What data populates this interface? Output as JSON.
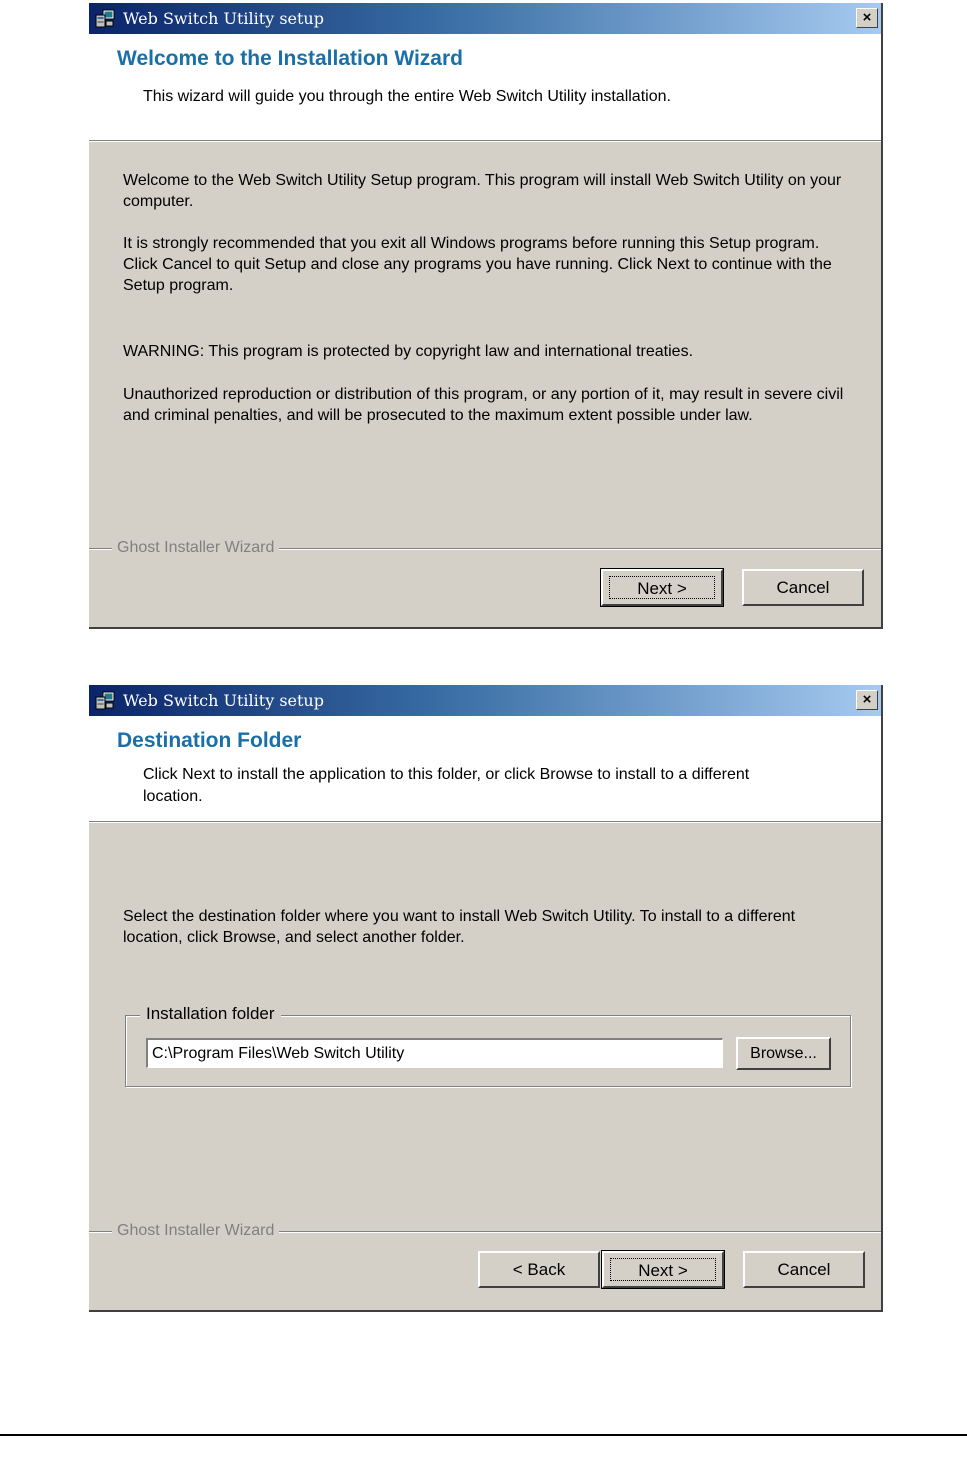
{
  "dialog1": {
    "window_title": "Web Switch Utility setup",
    "close_label": "×",
    "header_title": "Welcome to the Installation Wizard",
    "header_subtitle": "This wizard will guide you through the entire Web Switch Utility installation.",
    "paragraphs": [
      "Welcome to the Web Switch Utility Setup program. This program will install Web Switch Utility on your computer.",
      "It is strongly recommended that you exit all Windows programs before running this Setup program. Click Cancel to quit Setup and close any programs you have running. Click Next to continue with the Setup program.",
      "WARNING: This program is protected by copyright law and international treaties.",
      "Unauthorized reproduction or distribution of this program, or any portion of it, may result in severe civil and criminal penalties, and will be prosecuted to the maximum extent possible under law."
    ],
    "group_label": "Ghost Installer Wizard",
    "buttons": {
      "next": "Next >",
      "cancel": "Cancel"
    }
  },
  "dialog2": {
    "window_title": "Web Switch Utility setup",
    "close_label": "×",
    "header_title": "Destination Folder",
    "header_subtitle": "Click Next to install the application to this folder, or click Browse to install to a different location.",
    "instruction": "Select the destination folder where you want to install Web Switch Utility. To install to a different location, click Browse, and select another folder.",
    "folder_group_label": "Installation folder",
    "folder_path": "C:\\Program Files\\Web Switch Utility",
    "browse_label": "Browse...",
    "group_label": "Ghost Installer Wizard",
    "buttons": {
      "back": "< Back",
      "next": "Next >",
      "cancel": "Cancel"
    }
  },
  "icons": {
    "app": "setup-computer-icon",
    "close": "close-icon"
  },
  "colors": {
    "title_gradient_start": "#0a246a",
    "title_gradient_end": "#a6caf0",
    "header_title": "#1a6fa8",
    "dialog_face": "#d4d0c8"
  }
}
